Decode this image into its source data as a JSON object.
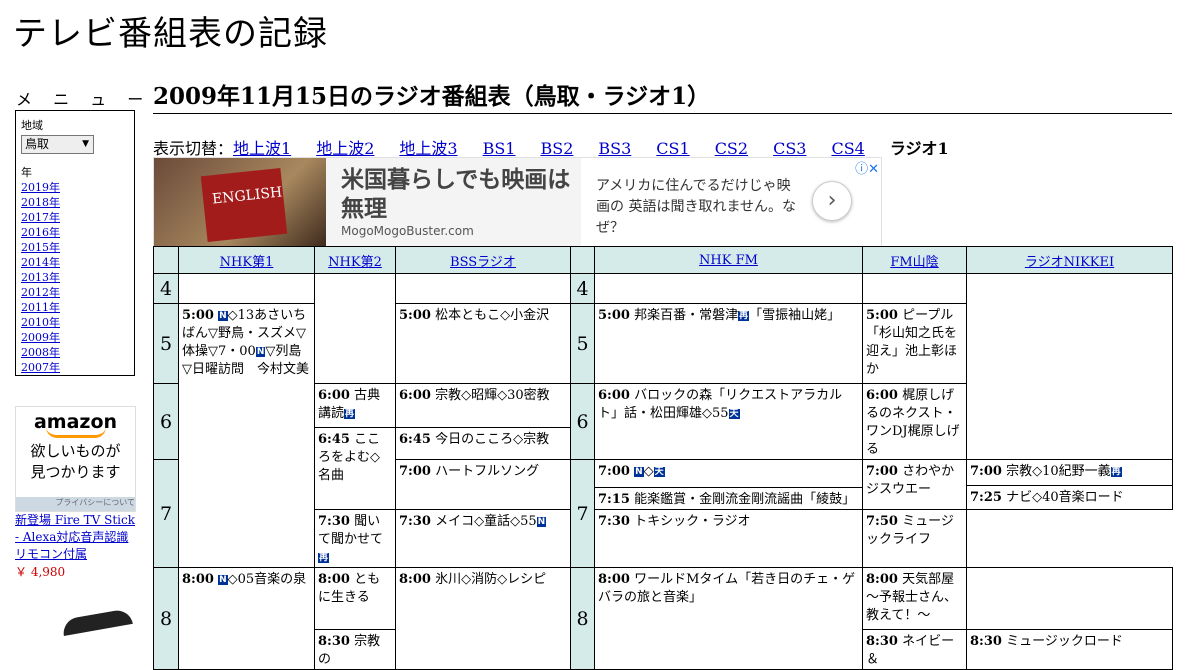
{
  "site": {
    "title": "テレビ番組表の記録"
  },
  "menu": {
    "heading": "メ ニ ュ ー",
    "region_label": "地域",
    "region_value": "鳥取",
    "year_label": "年",
    "years": [
      "2019年",
      "2018年",
      "2017年",
      "2016年",
      "2015年",
      "2014年",
      "2013年",
      "2012年",
      "2011年",
      "2010年",
      "2009年",
      "2008年",
      "2007年"
    ]
  },
  "ad_amazon": {
    "logo": "amazon",
    "tagline_1": "欲しいものが",
    "tagline_2": "見つかります",
    "privacy": "プライバシーについて",
    "product": "新登場 Fire TV Stick - Alexa対応音声認識リモコン付属",
    "price": "￥ 4,980"
  },
  "heading": "2009年11月15日のラジオ番組表（鳥取・ラジオ1）",
  "switcher": {
    "label": "表示切替：",
    "links": [
      "地上波1",
      "地上波2",
      "地上波3",
      "BS1",
      "BS2",
      "BS3",
      "CS1",
      "CS2",
      "CS3",
      "CS4"
    ],
    "current": "ラジオ1"
  },
  "banner": {
    "book_text": "ENGLISH",
    "headline": "米国暮らしでも映画は無理",
    "domain": "MogoMogoBuster.com",
    "description": "アメリカに住んでるだけじゃ映画の 英語は聞き取れません。なぜ？",
    "next": "›",
    "ad_mark": "ⓘ✕"
  },
  "channels": [
    "NHK第1",
    "NHK第2",
    "BSSラジオ",
    "NHK FM",
    "FM山陰",
    "ラジオNIKKEI"
  ],
  "hours": [
    "4",
    "5",
    "6",
    "7",
    "8"
  ],
  "programs": {
    "nhk1_5": {
      "time": "5:00",
      "mark": "N",
      "text": "◇13あさいちばん▽野鳥・スズメ▽体操▽7・00",
      "mark2": "N",
      "text2": "▽列島▽日曜訪問　今村文美"
    },
    "nhk1_8": {
      "time": "8:00",
      "mark": "N",
      "text": "◇05音楽の泉"
    },
    "nhk2_600": {
      "time": "6:00",
      "text": "古典講読",
      "mark": "再"
    },
    "nhk2_645": {
      "time": "6:45",
      "text": "こころをよむ◇名曲"
    },
    "nhk2_730": {
      "time": "7:30",
      "text": "聞いて聞かせて",
      "mark": "再"
    },
    "nhk2_800": {
      "time": "8:00",
      "text": "ともに生きる"
    },
    "nhk2_830": {
      "time": "8:30",
      "text": "宗教の"
    },
    "bss_500": {
      "time": "5:00",
      "text": "松本ともこ◇小金沢"
    },
    "bss_600": {
      "time": "6:00",
      "text": "宗教◇昭輝◇30密教"
    },
    "bss_645": {
      "time": "6:45",
      "text": "今日のこころ◇宗教"
    },
    "bss_700": {
      "time": "7:00",
      "text": "ハートフルソング"
    },
    "bss_730": {
      "time": "7:30",
      "text": "メイコ◇童話◇55",
      "mark": "N"
    },
    "bss_800": {
      "time": "8:00",
      "text": "氷川◇消防◇レシピ"
    },
    "fm_500": {
      "time": "5:00",
      "text": "邦楽百番・常磐津",
      "mark": "再",
      "text2": "「雪振袖山姥」"
    },
    "fm_600": {
      "time": "6:00",
      "text": "バロックの森「リクエストアラカルト」話・松田輝雄◇55",
      "mark": "天"
    },
    "fm_700": {
      "time": "7:00",
      "mark": "N",
      "text": "◇",
      "mark2": "天"
    },
    "fm_715": {
      "time": "7:15",
      "text": "能楽鑑賞・金剛流金剛流謡曲「綾鼓」"
    },
    "fm_800": {
      "time": "8:00",
      "text": "ワールドMタイム「若き日のチェ・ゲバラの旅と音楽」"
    },
    "san_500": {
      "time": "5:00",
      "text": "ピープル「杉山知之氏を迎え」池上彰ほか"
    },
    "san_600": {
      "time": "6:00",
      "text": "梶原しげるのネクスト・ワンDJ梶原しげる"
    },
    "san_700": {
      "time": "7:00",
      "text": "さわやかジスウエー"
    },
    "san_730": {
      "time": "7:30",
      "text": "トキシック・ラジオ"
    },
    "san_800": {
      "time": "8:00",
      "text": "天気部屋～予報士さん、教えて！～"
    },
    "san_830": {
      "time": "8:30",
      "text": "ネイビー＆"
    },
    "nik_700": {
      "time": "7:00",
      "text": "宗教◇10紀野一義",
      "mark": "再"
    },
    "nik_725": {
      "time": "7:25",
      "text": "ナビ◇40音楽ロード"
    },
    "nik_750": {
      "time": "7:50",
      "text": "ミュージックライフ"
    },
    "nik_830": {
      "time": "8:30",
      "text": "ミュージックロード"
    }
  }
}
